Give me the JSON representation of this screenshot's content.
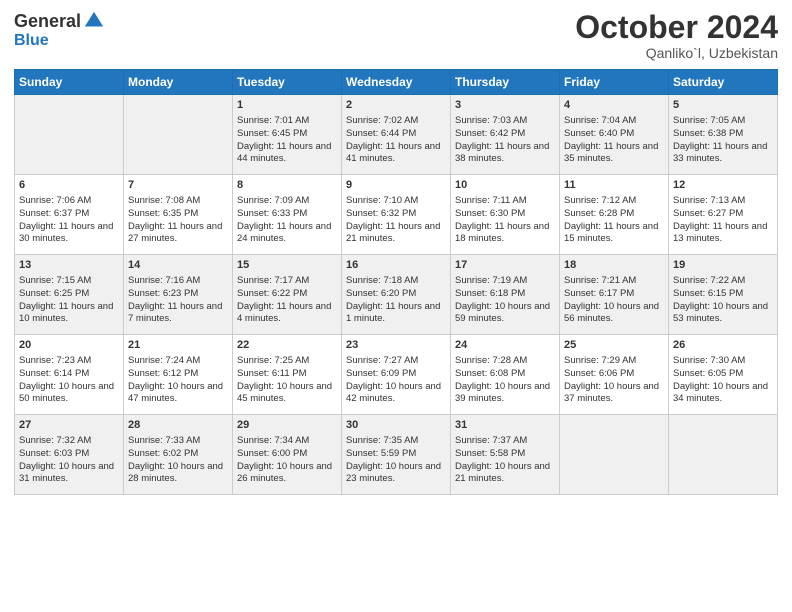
{
  "logo": {
    "general": "General",
    "blue": "Blue"
  },
  "title": "October 2024",
  "location": "Qanliko`l, Uzbekistan",
  "weekdays": [
    "Sunday",
    "Monday",
    "Tuesday",
    "Wednesday",
    "Thursday",
    "Friday",
    "Saturday"
  ],
  "weeks": [
    [
      {
        "day": "",
        "sunrise": "",
        "sunset": "",
        "daylight": ""
      },
      {
        "day": "",
        "sunrise": "",
        "sunset": "",
        "daylight": ""
      },
      {
        "day": "1",
        "sunrise": "Sunrise: 7:01 AM",
        "sunset": "Sunset: 6:45 PM",
        "daylight": "Daylight: 11 hours and 44 minutes."
      },
      {
        "day": "2",
        "sunrise": "Sunrise: 7:02 AM",
        "sunset": "Sunset: 6:44 PM",
        "daylight": "Daylight: 11 hours and 41 minutes."
      },
      {
        "day": "3",
        "sunrise": "Sunrise: 7:03 AM",
        "sunset": "Sunset: 6:42 PM",
        "daylight": "Daylight: 11 hours and 38 minutes."
      },
      {
        "day": "4",
        "sunrise": "Sunrise: 7:04 AM",
        "sunset": "Sunset: 6:40 PM",
        "daylight": "Daylight: 11 hours and 35 minutes."
      },
      {
        "day": "5",
        "sunrise": "Sunrise: 7:05 AM",
        "sunset": "Sunset: 6:38 PM",
        "daylight": "Daylight: 11 hours and 33 minutes."
      }
    ],
    [
      {
        "day": "6",
        "sunrise": "Sunrise: 7:06 AM",
        "sunset": "Sunset: 6:37 PM",
        "daylight": "Daylight: 11 hours and 30 minutes."
      },
      {
        "day": "7",
        "sunrise": "Sunrise: 7:08 AM",
        "sunset": "Sunset: 6:35 PM",
        "daylight": "Daylight: 11 hours and 27 minutes."
      },
      {
        "day": "8",
        "sunrise": "Sunrise: 7:09 AM",
        "sunset": "Sunset: 6:33 PM",
        "daylight": "Daylight: 11 hours and 24 minutes."
      },
      {
        "day": "9",
        "sunrise": "Sunrise: 7:10 AM",
        "sunset": "Sunset: 6:32 PM",
        "daylight": "Daylight: 11 hours and 21 minutes."
      },
      {
        "day": "10",
        "sunrise": "Sunrise: 7:11 AM",
        "sunset": "Sunset: 6:30 PM",
        "daylight": "Daylight: 11 hours and 18 minutes."
      },
      {
        "day": "11",
        "sunrise": "Sunrise: 7:12 AM",
        "sunset": "Sunset: 6:28 PM",
        "daylight": "Daylight: 11 hours and 15 minutes."
      },
      {
        "day": "12",
        "sunrise": "Sunrise: 7:13 AM",
        "sunset": "Sunset: 6:27 PM",
        "daylight": "Daylight: 11 hours and 13 minutes."
      }
    ],
    [
      {
        "day": "13",
        "sunrise": "Sunrise: 7:15 AM",
        "sunset": "Sunset: 6:25 PM",
        "daylight": "Daylight: 11 hours and 10 minutes."
      },
      {
        "day": "14",
        "sunrise": "Sunrise: 7:16 AM",
        "sunset": "Sunset: 6:23 PM",
        "daylight": "Daylight: 11 hours and 7 minutes."
      },
      {
        "day": "15",
        "sunrise": "Sunrise: 7:17 AM",
        "sunset": "Sunset: 6:22 PM",
        "daylight": "Daylight: 11 hours and 4 minutes."
      },
      {
        "day": "16",
        "sunrise": "Sunrise: 7:18 AM",
        "sunset": "Sunset: 6:20 PM",
        "daylight": "Daylight: 11 hours and 1 minute."
      },
      {
        "day": "17",
        "sunrise": "Sunrise: 7:19 AM",
        "sunset": "Sunset: 6:18 PM",
        "daylight": "Daylight: 10 hours and 59 minutes."
      },
      {
        "day": "18",
        "sunrise": "Sunrise: 7:21 AM",
        "sunset": "Sunset: 6:17 PM",
        "daylight": "Daylight: 10 hours and 56 minutes."
      },
      {
        "day": "19",
        "sunrise": "Sunrise: 7:22 AM",
        "sunset": "Sunset: 6:15 PM",
        "daylight": "Daylight: 10 hours and 53 minutes."
      }
    ],
    [
      {
        "day": "20",
        "sunrise": "Sunrise: 7:23 AM",
        "sunset": "Sunset: 6:14 PM",
        "daylight": "Daylight: 10 hours and 50 minutes."
      },
      {
        "day": "21",
        "sunrise": "Sunrise: 7:24 AM",
        "sunset": "Sunset: 6:12 PM",
        "daylight": "Daylight: 10 hours and 47 minutes."
      },
      {
        "day": "22",
        "sunrise": "Sunrise: 7:25 AM",
        "sunset": "Sunset: 6:11 PM",
        "daylight": "Daylight: 10 hours and 45 minutes."
      },
      {
        "day": "23",
        "sunrise": "Sunrise: 7:27 AM",
        "sunset": "Sunset: 6:09 PM",
        "daylight": "Daylight: 10 hours and 42 minutes."
      },
      {
        "day": "24",
        "sunrise": "Sunrise: 7:28 AM",
        "sunset": "Sunset: 6:08 PM",
        "daylight": "Daylight: 10 hours and 39 minutes."
      },
      {
        "day": "25",
        "sunrise": "Sunrise: 7:29 AM",
        "sunset": "Sunset: 6:06 PM",
        "daylight": "Daylight: 10 hours and 37 minutes."
      },
      {
        "day": "26",
        "sunrise": "Sunrise: 7:30 AM",
        "sunset": "Sunset: 6:05 PM",
        "daylight": "Daylight: 10 hours and 34 minutes."
      }
    ],
    [
      {
        "day": "27",
        "sunrise": "Sunrise: 7:32 AM",
        "sunset": "Sunset: 6:03 PM",
        "daylight": "Daylight: 10 hours and 31 minutes."
      },
      {
        "day": "28",
        "sunrise": "Sunrise: 7:33 AM",
        "sunset": "Sunset: 6:02 PM",
        "daylight": "Daylight: 10 hours and 28 minutes."
      },
      {
        "day": "29",
        "sunrise": "Sunrise: 7:34 AM",
        "sunset": "Sunset: 6:00 PM",
        "daylight": "Daylight: 10 hours and 26 minutes."
      },
      {
        "day": "30",
        "sunrise": "Sunrise: 7:35 AM",
        "sunset": "Sunset: 5:59 PM",
        "daylight": "Daylight: 10 hours and 23 minutes."
      },
      {
        "day": "31",
        "sunrise": "Sunrise: 7:37 AM",
        "sunset": "Sunset: 5:58 PM",
        "daylight": "Daylight: 10 hours and 21 minutes."
      },
      {
        "day": "",
        "sunrise": "",
        "sunset": "",
        "daylight": ""
      },
      {
        "day": "",
        "sunrise": "",
        "sunset": "",
        "daylight": ""
      }
    ]
  ]
}
